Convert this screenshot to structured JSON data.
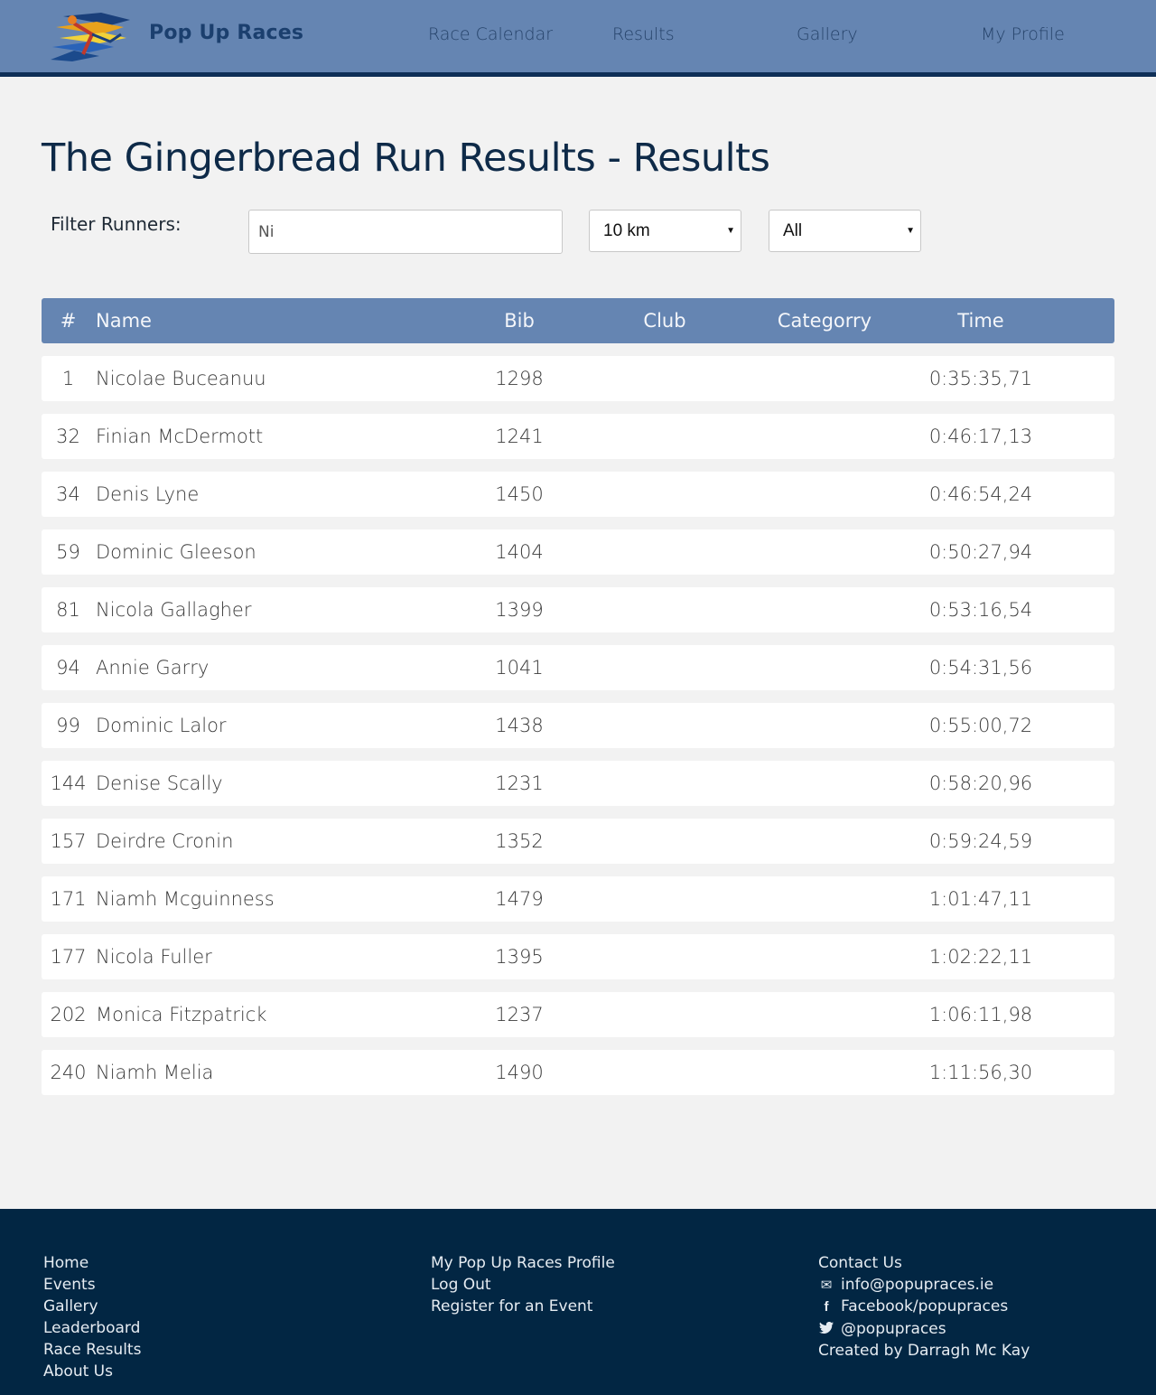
{
  "header": {
    "brand": "Pop Up Races",
    "nav": [
      {
        "label": "Race Calendar"
      },
      {
        "label": "Results"
      },
      {
        "label": "Gallery"
      },
      {
        "label": "My Profile"
      }
    ]
  },
  "page": {
    "title": "The Gingerbread Run Results - Results"
  },
  "filters": {
    "label": "Filter Runners:",
    "search_value": "Ni",
    "distance_selected": "10 km",
    "category_selected": "All"
  },
  "table": {
    "headers": {
      "rank": "#",
      "name": "Name",
      "bib": "Bib",
      "club": "Club",
      "category": "Categorry",
      "time": "Time"
    },
    "rows": [
      {
        "rank": "1",
        "name": "Nicolae Buceanuu",
        "bib": "1298",
        "club": "",
        "category": "",
        "time": "0:35:35,71"
      },
      {
        "rank": "32",
        "name": "Finian McDermott",
        "bib": "1241",
        "club": "",
        "category": "",
        "time": "0:46:17,13"
      },
      {
        "rank": "34",
        "name": "Denis Lyne",
        "bib": "1450",
        "club": "",
        "category": "",
        "time": "0:46:54,24"
      },
      {
        "rank": "59",
        "name": "Dominic Gleeson",
        "bib": "1404",
        "club": "",
        "category": "",
        "time": "0:50:27,94"
      },
      {
        "rank": "81",
        "name": "Nicola Gallagher",
        "bib": "1399",
        "club": "",
        "category": "",
        "time": "0:53:16,54"
      },
      {
        "rank": "94",
        "name": "Annie Garry",
        "bib": "1041",
        "club": "",
        "category": "",
        "time": "0:54:31,56"
      },
      {
        "rank": "99",
        "name": "Dominic Lalor",
        "bib": "1438",
        "club": "",
        "category": "",
        "time": "0:55:00,72"
      },
      {
        "rank": "144",
        "name": "Denise Scally",
        "bib": "1231",
        "club": "",
        "category": "",
        "time": "0:58:20,96"
      },
      {
        "rank": "157",
        "name": "Deirdre Cronin",
        "bib": "1352",
        "club": "",
        "category": "",
        "time": "0:59:24,59"
      },
      {
        "rank": "171",
        "name": "Niamh Mcguinness",
        "bib": "1479",
        "club": "",
        "category": "",
        "time": "1:01:47,11"
      },
      {
        "rank": "177",
        "name": "Nicola Fuller",
        "bib": "1395",
        "club": "",
        "category": "",
        "time": "1:02:22,11"
      },
      {
        "rank": "202",
        "name": "Monica Fitzpatrick",
        "bib": "1237",
        "club": "",
        "category": "",
        "time": "1:06:11,98"
      },
      {
        "rank": "240",
        "name": "Niamh Melia",
        "bib": "1490",
        "club": "",
        "category": "",
        "time": "1:11:56,30"
      }
    ]
  },
  "footer": {
    "col1": [
      "Home",
      "Events",
      "Gallery",
      "Leaderboard",
      "Race Results",
      "About Us"
    ],
    "col2": [
      "My Pop Up Races Profile",
      "Log Out",
      "Register for an Event"
    ],
    "contact_title": "Contact Us",
    "email": "info@popupraces.ie",
    "facebook": "Facebook/popupraces",
    "twitter": "@popupraces",
    "credit": "Created by Darragh Mc Kay"
  },
  "icons": {
    "logo": "runner-logo",
    "email": "envelope-icon",
    "facebook": "facebook-icon",
    "twitter": "twitter-icon"
  },
  "colors": {
    "nav_bg": "#6585b2",
    "nav_border": "#0f2f57",
    "footer_bg": "#022643",
    "table_header_bg": "#6585b2",
    "page_bg": "#f2f2f2"
  }
}
